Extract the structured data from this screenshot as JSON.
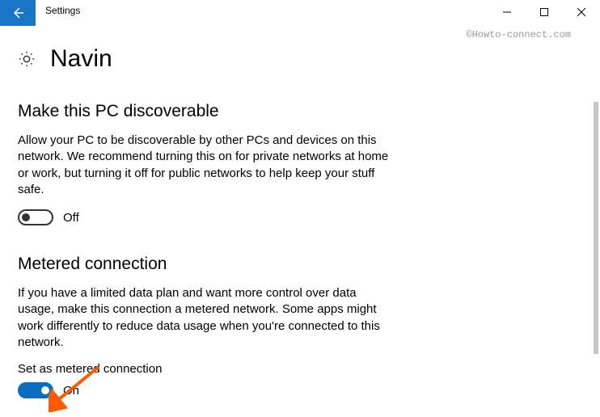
{
  "titlebar": {
    "title": "Settings"
  },
  "watermark": "©Howto-connect.com",
  "header": {
    "title": "Navin"
  },
  "sections": {
    "discoverable": {
      "heading": "Make this PC discoverable",
      "description": "Allow your PC to be discoverable by other PCs and devices on this network. We recommend turning this on for private networks at home or work, but turning it off for public networks to help keep your stuff safe.",
      "toggle_state": "Off"
    },
    "metered": {
      "heading": "Metered connection",
      "description": "If you have a limited data plan and want more control over data usage, make this connection a metered network. Some apps might work differently to reduce data usage when you're connected to this network.",
      "sub_label": "Set as metered connection",
      "toggle_state": "On"
    }
  }
}
